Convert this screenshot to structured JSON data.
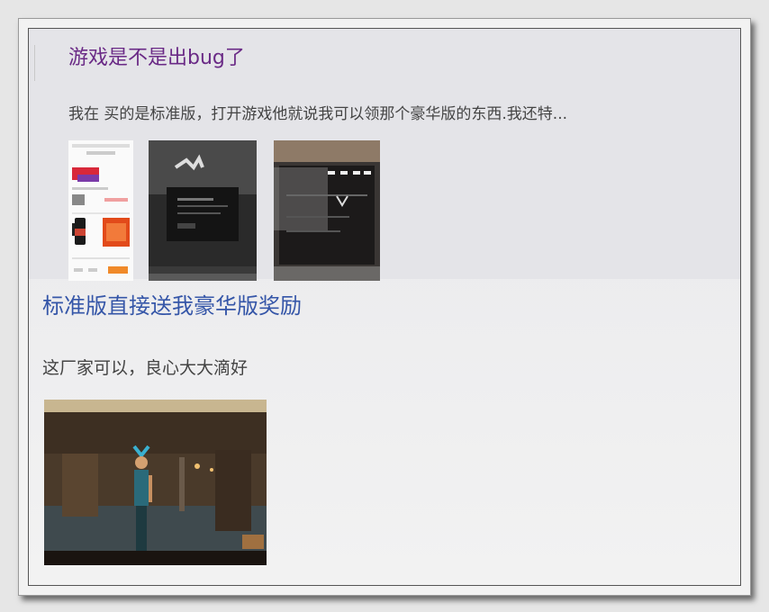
{
  "posts": [
    {
      "title": "游戏是不是出bug了",
      "excerpt": "我在       买的是标准版，打开游戏他就说我可以领那个豪华版的东西.我还特...",
      "images": [
        "phone-screenshot",
        "game-screen-photo",
        "game-menu-photo"
      ]
    },
    {
      "title": "标准版直接送我豪华版奖励",
      "excerpt": "这厂家可以，良心大大滴好",
      "images": [
        "game-scene-screenshot"
      ]
    }
  ],
  "colors": {
    "title_primary": "#6a2a86",
    "title_secondary": "#3556a8",
    "text": "#444444"
  }
}
